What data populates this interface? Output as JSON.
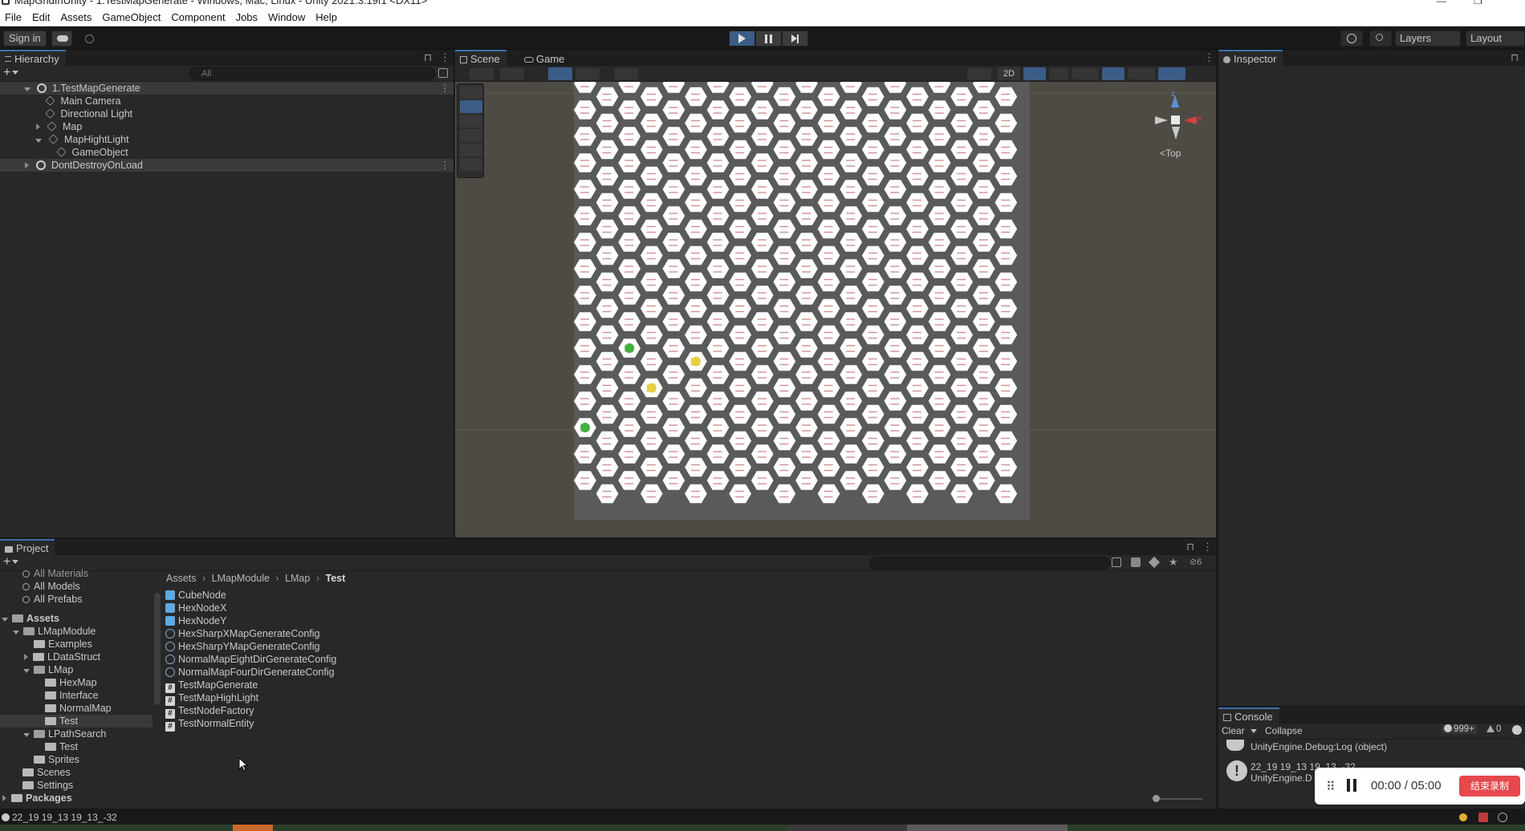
{
  "window": {
    "title": "MapGridInUnity - 1.TestMapGenerate - Windows, Mac, Linux - Unity 2021.3.19f1 <DX11>"
  },
  "menu": [
    "File",
    "Edit",
    "Assets",
    "GameObject",
    "Component",
    "Jobs",
    "Window",
    "Help"
  ],
  "toolbar": {
    "sign_in": "Sign in",
    "layers": "Layers",
    "layout": "Layout"
  },
  "hierarchy": {
    "tab": "Hierarchy",
    "search_placeholder": "All",
    "items": [
      {
        "label": "1.TestMapGenerate"
      },
      {
        "label": "Main Camera"
      },
      {
        "label": "Directional Light"
      },
      {
        "label": "Map"
      },
      {
        "label": "MapHightLight"
      },
      {
        "label": "GameObject"
      },
      {
        "label": "DontDestroyOnLoad"
      }
    ]
  },
  "scene": {
    "tabs": [
      "Scene",
      "Game"
    ],
    "mode_2d": "2D",
    "gizmo_label": "Top",
    "axis_x": "x",
    "axis_z": "z",
    "hex_cols": 20,
    "hex_rows": 16
  },
  "inspector": {
    "tab": "Inspector"
  },
  "project": {
    "tab": "Project",
    "favorites": [
      "All Materials",
      "All Models",
      "All Prefabs"
    ],
    "tree": [
      {
        "label": "Assets"
      },
      {
        "label": "LMapModule"
      },
      {
        "label": "Examples"
      },
      {
        "label": "LDataStruct"
      },
      {
        "label": "LMap"
      },
      {
        "label": "HexMap"
      },
      {
        "label": "Interface"
      },
      {
        "label": "NormalMap"
      },
      {
        "label": "Test"
      },
      {
        "label": "LPathSearch"
      },
      {
        "label": "Test"
      },
      {
        "label": "Sprites"
      },
      {
        "label": "Scenes"
      },
      {
        "label": "Settings"
      },
      {
        "label": "Packages"
      }
    ],
    "breadcrumb": [
      "Assets",
      "LMapModule",
      "LMap",
      "Test"
    ],
    "hidden_count": "6",
    "files": [
      {
        "name": "CubeNode",
        "type": "prefab"
      },
      {
        "name": "HexNodeX",
        "type": "prefab"
      },
      {
        "name": "HexNodeY",
        "type": "prefab"
      },
      {
        "name": "HexSharpXMapGenerateConfig",
        "type": "so"
      },
      {
        "name": "HexSharpYMapGenerateConfig",
        "type": "so"
      },
      {
        "name": "NormalMapEightDirGenerateConfig",
        "type": "so"
      },
      {
        "name": "NormalMapFourDirGenerateConfig",
        "type": "so"
      },
      {
        "name": "TestMapGenerate",
        "type": "cs"
      },
      {
        "name": "TestMapHighLight",
        "type": "cs"
      },
      {
        "name": "TestNodeFactory",
        "type": "cs"
      },
      {
        "name": "TestNormalEntity",
        "type": "cs"
      }
    ]
  },
  "console": {
    "tab": "Console",
    "clear": "Clear",
    "collapse": "Collapse",
    "count_logs": "999+",
    "count_warn": "0",
    "entries": [
      {
        "line1": "UnityEngine.Debug:Log (object)"
      },
      {
        "line1": "22_19 19_13 19_13_-32",
        "line2": "UnityEngine.D"
      }
    ]
  },
  "status": {
    "text": "22_19 19_13 19_13_-32"
  },
  "recorder": {
    "time": "00:00 / 05:00",
    "stop_label": "结束录制"
  }
}
